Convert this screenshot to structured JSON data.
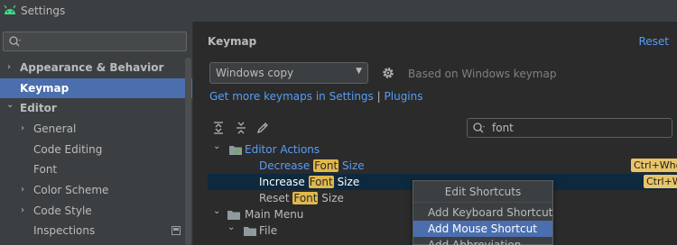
{
  "window": {
    "title": "Settings"
  },
  "sidebar": {
    "search_placeholder": "",
    "items": [
      {
        "label": "Appearance & Behavior",
        "arrow": "›",
        "bold": true
      },
      {
        "label": "Keymap",
        "bold": true,
        "selected": true
      },
      {
        "label": "Editor",
        "arrow": "⌄",
        "bold": true
      },
      {
        "label": "General",
        "arrow": "›"
      },
      {
        "label": "Code Editing"
      },
      {
        "label": "Font"
      },
      {
        "label": "Color Scheme",
        "arrow": "›"
      },
      {
        "label": "Code Style",
        "arrow": "›"
      },
      {
        "label": "Inspections"
      }
    ]
  },
  "main": {
    "title": "Keymap",
    "reset_label": "Reset",
    "keymap_select": "Windows copy",
    "based_on": "Based on Windows keymap",
    "link_keymaps": "Get more keymaps in Settings",
    "link_sep": "|",
    "link_plugins": "Plugins",
    "filter_value": "font"
  },
  "tree": {
    "editor_actions": "Editor Actions",
    "decrease": {
      "before": "Decrease ",
      "hl": "Font",
      "after": " Size",
      "shortcut": "Ctrl+Whee"
    },
    "increase": {
      "before": "Increase ",
      "hl": "Font",
      "after": " Size",
      "shortcut": "Ctrl+W"
    },
    "reset": {
      "before": "Reset ",
      "hl": "Font",
      "after": " Size"
    },
    "main_menu": "Main Menu",
    "file": "File"
  },
  "popup": {
    "title": "Edit Shortcuts",
    "items": [
      "Add Keyboard Shortcut",
      "Add Mouse Shortcut",
      "Add Abbreviation"
    ]
  },
  "colors": {
    "accent": "#4b6eaf",
    "link": "#589df6",
    "highlight": "#e0b84e"
  }
}
